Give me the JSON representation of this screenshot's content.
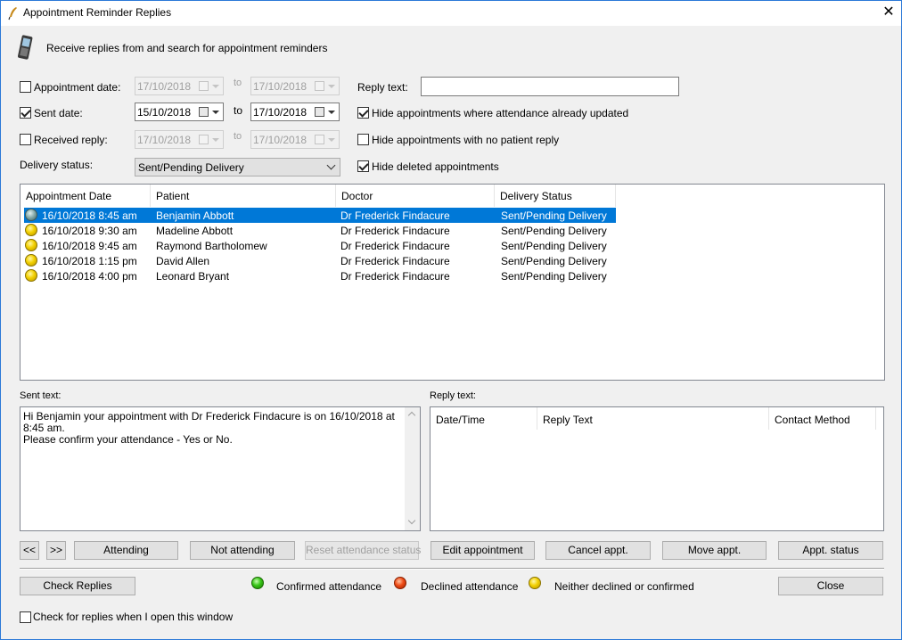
{
  "window": {
    "title": "Appointment Reminder Replies",
    "close_glyph": "✕"
  },
  "header": {
    "description": "Receive replies from and search for appointment reminders",
    "icon": "mobile-phone-icon"
  },
  "filters": {
    "appointment_date": {
      "label": "Appointment date:",
      "checked": false,
      "from": "17/10/2018",
      "to_label": "to",
      "to": "17/10/2018"
    },
    "sent_date": {
      "label": "Sent date:",
      "checked": true,
      "from": "15/10/2018",
      "to_label": "to",
      "to": "17/10/2018"
    },
    "received_reply": {
      "label": "Received reply:",
      "checked": false,
      "from": "17/10/2018",
      "to_label": "to",
      "to": "17/10/2018"
    },
    "delivery_status": {
      "label": "Delivery status:",
      "selected": "Sent/Pending Delivery"
    },
    "reply_text": {
      "label": "Reply text:",
      "value": ""
    },
    "hide_attendance_updated": {
      "label": "Hide appointments where attendance already updated",
      "checked": true
    },
    "hide_no_reply": {
      "label": "Hide appointments with no patient reply",
      "checked": false
    },
    "hide_deleted": {
      "label": "Hide deleted appointments",
      "checked": true
    }
  },
  "appointments": {
    "columns": [
      "Appointment Date",
      "Patient",
      "Doctor",
      "Delivery Status"
    ],
    "rows": [
      {
        "status_color": "grey",
        "date": "16/10/2018 8:45 am",
        "patient": "Benjamin Abbott",
        "doctor": "Dr Frederick Findacure",
        "delivery": "Sent/Pending Delivery",
        "selected": true
      },
      {
        "status_color": "yellow",
        "date": "16/10/2018 9:30 am",
        "patient": "Madeline Abbott",
        "doctor": "Dr Frederick Findacure",
        "delivery": "Sent/Pending Delivery",
        "selected": false
      },
      {
        "status_color": "yellow",
        "date": "16/10/2018 9:45 am",
        "patient": "Raymond Bartholomew",
        "doctor": "Dr Frederick Findacure",
        "delivery": "Sent/Pending Delivery",
        "selected": false
      },
      {
        "status_color": "yellow",
        "date": "16/10/2018 1:15 pm",
        "patient": "David Allen",
        "doctor": "Dr Frederick Findacure",
        "delivery": "Sent/Pending Delivery",
        "selected": false
      },
      {
        "status_color": "yellow",
        "date": "16/10/2018 4:00 pm",
        "patient": "Leonard Bryant",
        "doctor": "Dr Frederick Findacure",
        "delivery": "Sent/Pending Delivery",
        "selected": false
      }
    ]
  },
  "sent_text": {
    "label": "Sent text:",
    "value": "Hi Benjamin your appointment with Dr Frederick Findacure is on 16/10/2018 at 8:45 am.\nPlease confirm your attendance - Yes or No."
  },
  "reply_text_panel": {
    "label": "Reply text:",
    "columns": [
      "Date/Time",
      "Reply Text",
      "Contact Method"
    ]
  },
  "nav": {
    "prev": "<<",
    "next": ">>"
  },
  "actions": {
    "attending": "Attending",
    "not_attending": "Not attending",
    "reset_attendance": "Reset attendance status",
    "edit_appointment": "Edit appointment",
    "cancel_appt": "Cancel appt.",
    "move_appt": "Move appt.",
    "appt_status": "Appt. status"
  },
  "footer": {
    "check_replies": "Check Replies",
    "close": "Close",
    "check_on_open": {
      "label": "Check for replies when I open this window",
      "checked": false
    }
  },
  "legend": {
    "confirmed": "Confirmed attendance",
    "declined": "Declined attendance",
    "neither": "Neither declined or confirmed"
  },
  "colors": {
    "selection": "#0078d7",
    "window_bg": "#f0f0f0",
    "confirmed": "#36c416",
    "declined": "#ef4b16",
    "neither": "#f2d000"
  }
}
